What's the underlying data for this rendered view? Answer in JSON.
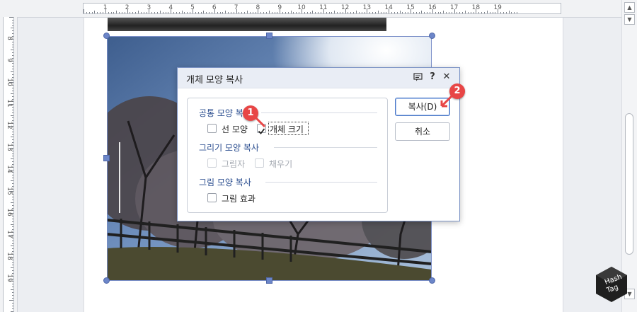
{
  "ruler": {
    "horizontal_numbers": [
      "1",
      "2",
      "3",
      "4",
      "5",
      "6",
      "7",
      "8",
      "9",
      "10",
      "11",
      "12",
      "13",
      "14",
      "15",
      "16",
      "17",
      "18",
      "19"
    ],
    "vertical_numbers": [
      "8",
      "9",
      "10",
      "11",
      "12",
      "13",
      "14",
      "15",
      "16",
      "17",
      "18",
      "19"
    ]
  },
  "dialog": {
    "title": "개체 모양 복사",
    "title_buttons": {
      "help": "?",
      "close": "✕"
    },
    "sections": {
      "common": {
        "title": "공통 모양 복사",
        "line_shape": {
          "label": "선 모양",
          "checked": false
        },
        "object_size": {
          "label": "개체 크기",
          "checked": true
        }
      },
      "drawing": {
        "title": "그리기 모양 복사",
        "shadow": {
          "label": "그림자",
          "checked": false,
          "disabled": true
        },
        "fill": {
          "label": "채우기",
          "checked": false,
          "disabled": true
        }
      },
      "picture": {
        "title": "그림 모양 복사",
        "picture_effect": {
          "label": "그림 효과",
          "checked": false
        }
      }
    },
    "buttons": {
      "copy": "복사(D)",
      "cancel": "취소"
    }
  },
  "annotations": {
    "step1": "1",
    "step2": "2"
  },
  "watermark": {
    "line1": "Hash",
    "line2": "Tag"
  },
  "colors": {
    "accent": "#2a4d8f",
    "badge": "#e84646",
    "selection": "#6c86c9"
  }
}
